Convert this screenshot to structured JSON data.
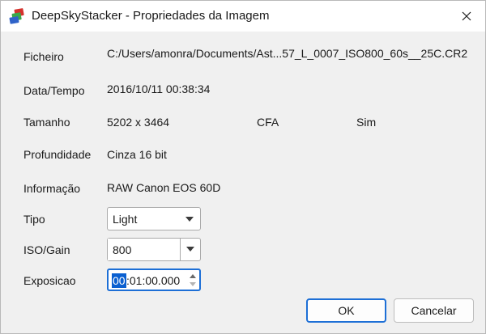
{
  "window": {
    "title": "DeepSkyStacker - Propriedades da Imagem"
  },
  "fields": {
    "file_label": "Ficheiro",
    "file_value": "C:/Users/amonra/Documents/Ast...57_L_0007_ISO800_60s__25C.CR2",
    "datetime_label": "Data/Tempo",
    "datetime_value": "2016/10/11 00:38:34",
    "size_label": "Tamanho",
    "size_value": "5202 x 3464",
    "cfa_value": "CFA",
    "cfa_flag_value": "Sim",
    "depth_label": "Profundidade",
    "depth_value": "Cinza 16 bit",
    "info_label": "Informação",
    "info_value": "RAW Canon EOS 60D",
    "type_label": "Tipo",
    "type_selected": "Light",
    "iso_label": "ISO/Gain",
    "iso_value": "800",
    "exposure_label": "Exposicao",
    "exposure_selected_part": "00",
    "exposure_rest": ":01:00.000"
  },
  "buttons": {
    "ok_label": "OK",
    "cancel_label": "Cancelar"
  },
  "colors": {
    "accent": "#1d6fd6",
    "selection": "#0a5fd0",
    "background": "#f0f0f0"
  },
  "icons": {
    "app": "deepskystacker-app-icon",
    "close": "close-icon"
  }
}
